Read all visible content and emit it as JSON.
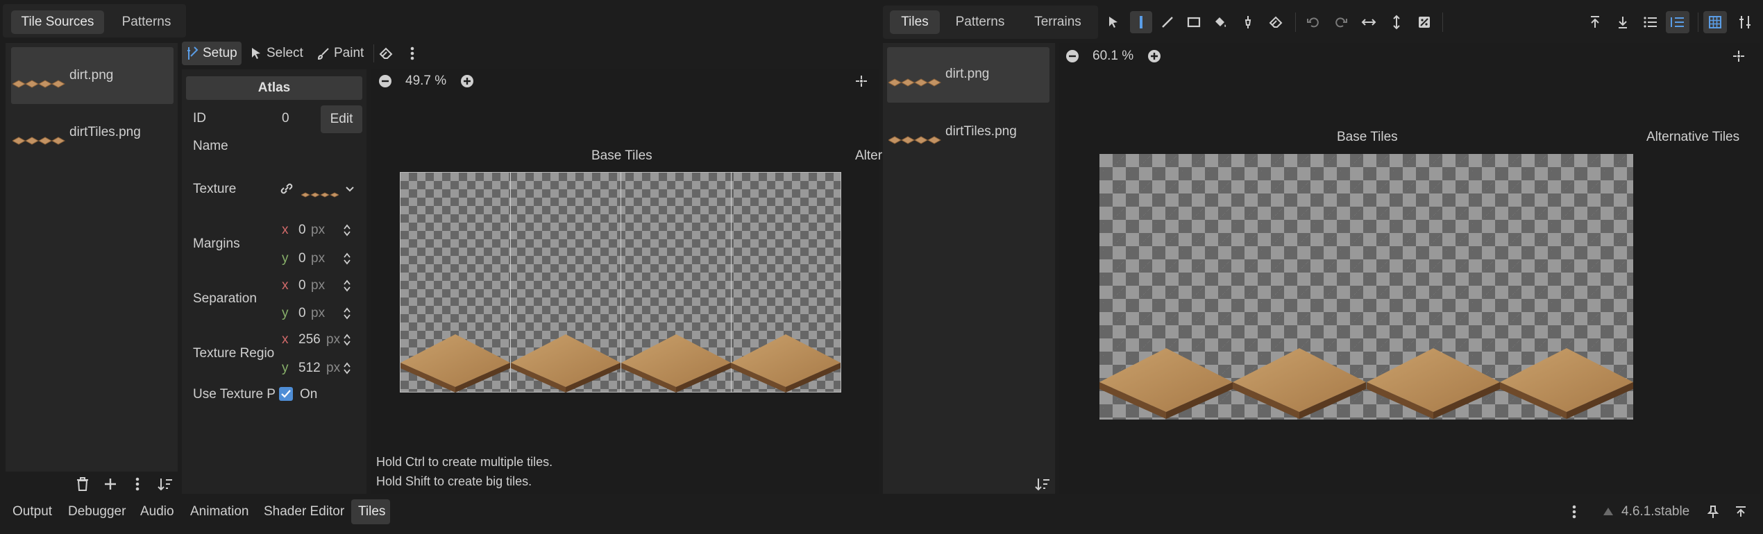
{
  "left_tabs": [
    "Tile Sources",
    "Patterns"
  ],
  "left_sources": [
    {
      "name": "dirt.png"
    },
    {
      "name": "dirtTiles.png"
    }
  ],
  "setup_tabs": {
    "setup": "Setup",
    "select": "Select",
    "paint": "Paint"
  },
  "atlas": {
    "header": "Atlas",
    "id_label": "ID",
    "id_value": "0",
    "edit_label": "Edit",
    "name_label": "Name",
    "name_value": "",
    "texture_label": "Texture",
    "margins_label": "Margins",
    "margins_x": "0",
    "margins_y": "0",
    "separation_label": "Separation",
    "separation_x": "0",
    "separation_y": "0",
    "region_label": "Texture Regio",
    "region_x": "256",
    "region_y": "512",
    "padding_label": "Use Texture P",
    "padding_value": "On",
    "unit": "px",
    "x_label": "x",
    "y_label": "y"
  },
  "left_view": {
    "zoom": "49.7 %",
    "base_tiles": "Base Tiles",
    "alt_tiles": "Alter",
    "hint1": "Hold Ctrl to create multiple tiles.",
    "hint2": "Hold Shift to create big tiles."
  },
  "right_tabs": [
    "Tiles",
    "Patterns",
    "Terrains"
  ],
  "right_sources": [
    {
      "name": "dirt.png"
    },
    {
      "name": "dirtTiles.png"
    }
  ],
  "right_view": {
    "zoom": "60.1 %",
    "base_tiles": "Base Tiles",
    "alt_tiles": "Alternative Tiles"
  },
  "bottom_tabs": [
    "Output",
    "Debugger",
    "Audio",
    "Animation",
    "Shader Editor",
    "Tiles"
  ],
  "version": "4.6.1.stable",
  "colors": {
    "accent": "#4f8ed6",
    "tile": "#b48552"
  }
}
